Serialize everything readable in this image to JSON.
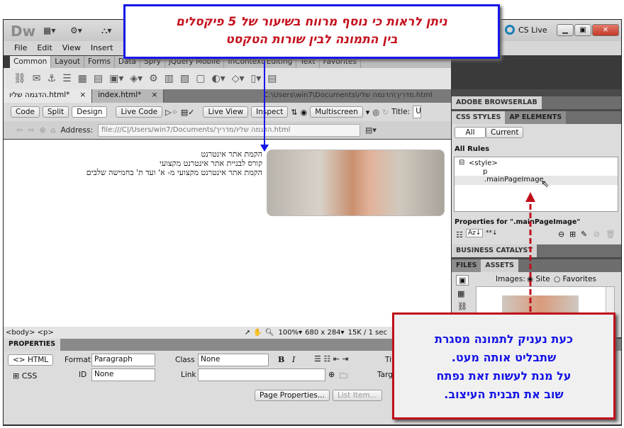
{
  "annotations": {
    "top_callout": [
      "ניתן לראות כי נוסף מרווח בשיעור של 5 פיקסלים",
      "בין התמונה לבין שורות הטקסט"
    ],
    "bottom_callout": [
      "כעת נעניק לתמונה מסגרת",
      "שתבליט אותה מעט.",
      "על מנת לעשות זאת נפתח",
      "שוב את תבנית העיצוב."
    ],
    "top_arrow_color": "#1616e8",
    "bottom_arrow_color": "#c0101a"
  },
  "app": {
    "logo": "Dw",
    "cs_live": "CS Live"
  },
  "menu": [
    "File",
    "Edit",
    "View",
    "Insert",
    "M"
  ],
  "insert_tabs": [
    "Common",
    "Layout",
    "Forms",
    "Data",
    "Spry",
    "jQuery Mobile",
    "InContext Editing",
    "Text",
    "Favorites"
  ],
  "doc_tabs": [
    {
      "label": "הדגמה שליו.html*"
    },
    {
      "label": "index.html*"
    }
  ],
  "doc_path": "C:\\Users\\win7\\Documents\\מדריך\\הדגמה שליו.html",
  "doc_toolbar": {
    "code": "Code",
    "split": "Split",
    "design": "Design",
    "live_code": "Live Code",
    "live_view": "Live View",
    "inspect": "Inspect",
    "multiscreen": "Multiscreen",
    "title_label": "Title:",
    "title_value": "Un"
  },
  "address": {
    "label": "Address:",
    "value": "file:///C|/Users/win7/Documents/הדגמה שליו/מדריך.html"
  },
  "content": {
    "lines": [
      "הקמת אתר אינטרנט",
      "קורס לבניית אתר אינטרנט מקצועי",
      "הקמת אתר אינטרנט מקצועי מ- א' ועד ת' בחמישה שלבים"
    ]
  },
  "status": {
    "tags": "<body> <p>",
    "zoom": "100%",
    "size": "680 x 284",
    "download": "15K / 1 sec"
  },
  "properties": {
    "header": "PROPERTIES",
    "html": "HTML",
    "css": "CSS",
    "format_label": "Format",
    "format": "Paragraph",
    "id_label": "ID",
    "id": "None",
    "class_label": "Class",
    "class": "None",
    "link_label": "Link",
    "link": "",
    "title_label": "Tit",
    "target_label": "Targ",
    "page_properties": "Page Properties...",
    "list_item": "List Item..."
  },
  "panels": {
    "browserlab": "ADOBE BROWSERLAB",
    "css_styles": "CSS STYLES",
    "ap_elements": "AP ELEMENTS",
    "all": "All",
    "current": "Current",
    "all_rules": "All Rules",
    "rules": [
      "<style>",
      "p",
      ".mainPageImage"
    ],
    "properties_for": "Properties for \".mainPageImage\"",
    "business_catalyst": "BUSINESS CATALYST",
    "files": "FILES",
    "assets": "ASSETS",
    "images_label": "Images:",
    "site": "Site",
    "favorites": "Favorites"
  }
}
